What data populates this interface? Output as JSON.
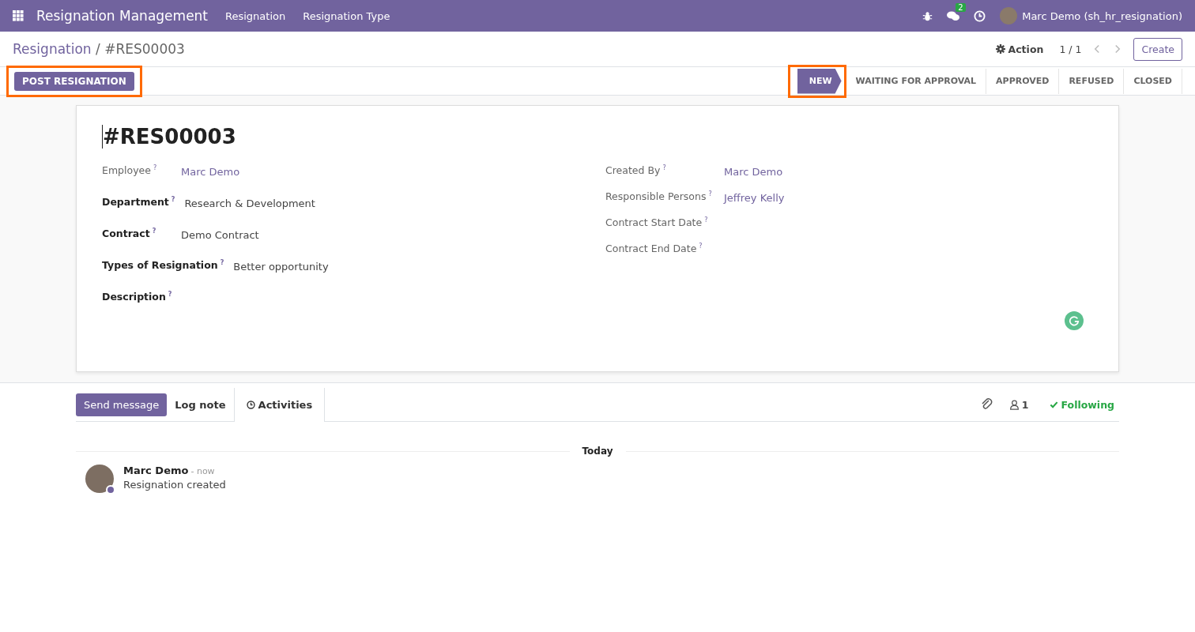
{
  "navbar": {
    "app_name": "Resignation Management",
    "menu": [
      "Resignation",
      "Resignation Type"
    ],
    "messages_count": "2",
    "user": "Marc Demo (sh_hr_resignation)"
  },
  "breadcrumb": {
    "parent": "Resignation",
    "separator": "/",
    "current": "#RES00003"
  },
  "control": {
    "action": "Action",
    "pager": "1 / 1",
    "create": "Create"
  },
  "header_buttons": [
    {
      "label": "POST RESIGNATION",
      "highlighted": true
    }
  ],
  "stages": [
    {
      "label": "NEW",
      "selected": true,
      "highlighted": true
    },
    {
      "label": "WAITING FOR APPROVAL",
      "selected": false,
      "highlighted": false
    },
    {
      "label": "APPROVED",
      "selected": false,
      "highlighted": false
    },
    {
      "label": "REFUSED",
      "selected": false,
      "highlighted": false
    },
    {
      "label": "CLOSED",
      "selected": false,
      "highlighted": false
    }
  ],
  "record": {
    "title": "#RES00003",
    "left_fields": [
      {
        "label": "Employee",
        "required": false,
        "kind": "link",
        "value": "Marc Demo"
      },
      {
        "label": "Department",
        "required": true,
        "kind": "text",
        "value": "Research & Development"
      },
      {
        "label": "Contract",
        "required": true,
        "kind": "text",
        "value": "Demo Contract"
      },
      {
        "label": "Types of Resignation",
        "required": true,
        "kind": "text",
        "value": "Better opportunity"
      },
      {
        "label": "Description",
        "required": true
      }
    ],
    "right_fields": [
      {
        "label": "Created By",
        "required": false,
        "kind": "link",
        "value": "Marc Demo"
      },
      {
        "label": "Responsible Persons",
        "required": false,
        "kind": "link",
        "value": "Jeffrey Kelly"
      },
      {
        "label": "Contract Start Date",
        "required": false
      },
      {
        "label": "Contract End Date",
        "required": false
      }
    ],
    "help_mark": "?"
  },
  "chatter": {
    "tabs": [
      {
        "label": "Send message",
        "selected": true
      },
      {
        "label": "Log note",
        "selected": false
      },
      {
        "label": "Activities",
        "selected": false
      }
    ],
    "followers": "1",
    "following": "Following",
    "date_separator": "Today",
    "messages": [
      {
        "author": "Marc Demo",
        "time": "- now",
        "body": "Resignation created"
      }
    ]
  }
}
